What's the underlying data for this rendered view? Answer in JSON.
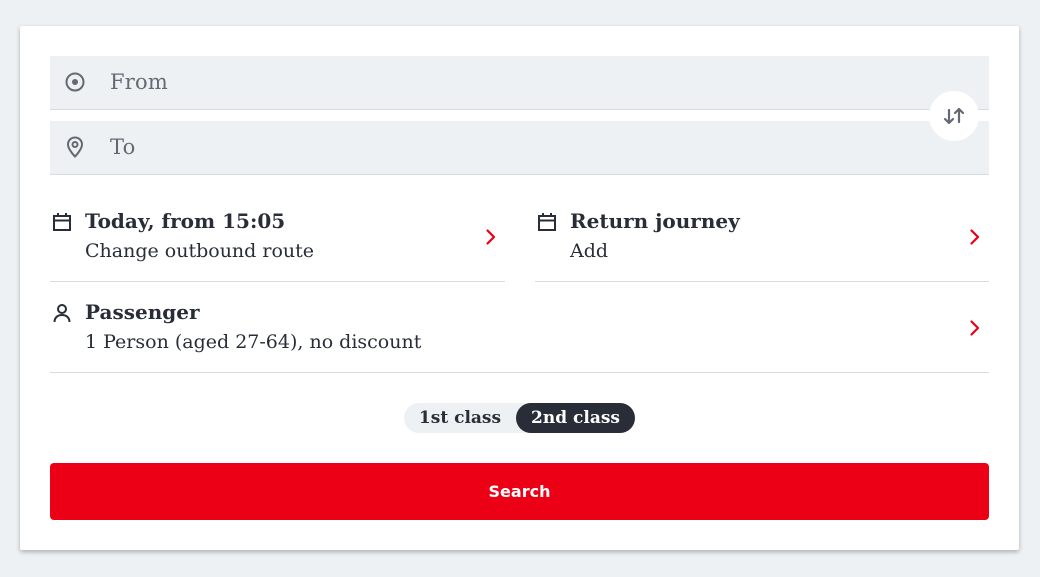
{
  "form": {
    "from_placeholder": "From",
    "to_placeholder": "To",
    "swap_icon": "swap-vertical-icon"
  },
  "outbound": {
    "title": "Today, from 15:05",
    "subtitle": "Change outbound route"
  },
  "return": {
    "title": "Return journey",
    "subtitle": "Add"
  },
  "passenger": {
    "title": "Passenger",
    "subtitle": "1 Person (aged 27-64), no discount"
  },
  "travel_class": {
    "options": [
      "1st class",
      "2nd class"
    ],
    "selected": "2nd class"
  },
  "search_label": "Search",
  "colors": {
    "accent": "#ec0016",
    "text": "#282d37",
    "field_bg": "#eef1f4",
    "page_bg": "#eef1f4"
  }
}
